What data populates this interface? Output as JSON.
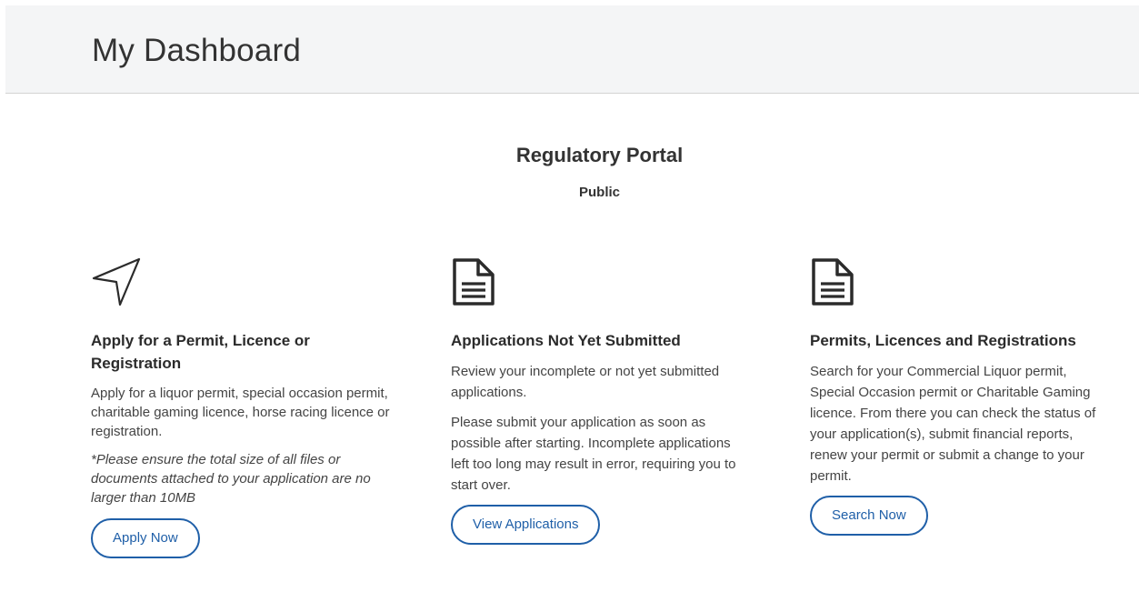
{
  "header": {
    "title": "My Dashboard"
  },
  "portal": {
    "title": "Regulatory Portal",
    "subtitle": "Public"
  },
  "cards": [
    {
      "icon": "paper-plane-icon",
      "title": "Apply for a Permit, Licence or Registration",
      "text": "Apply for a liquor permit, special occasion permit, charitable gaming licence, horse racing licence or registration.",
      "note": "*Please ensure the total size of all files or documents attached to your application are no larger than 10MB",
      "button_label": "Apply Now"
    },
    {
      "icon": "document-icon",
      "title": "Applications Not Yet Submitted",
      "text": "Review your incomplete or not yet submitted applications.",
      "text2": "Please submit your application as soon as possible after starting. Incomplete applications left too long may result in error, requiring you to start over.",
      "button_label": "View Applications"
    },
    {
      "icon": "document-icon",
      "title": "Permits, Licences and Registrations",
      "text": "Search for your Commercial Liquor permit, Special Occasion permit or Charitable Gaming licence. From there you can check the status of your application(s), submit financial reports, renew your permit or submit a change to your permit.",
      "button_label": "Search Now"
    }
  ],
  "colors": {
    "accent": "#1f5fa8",
    "header_bg": "#f4f5f6",
    "text": "#333333"
  }
}
